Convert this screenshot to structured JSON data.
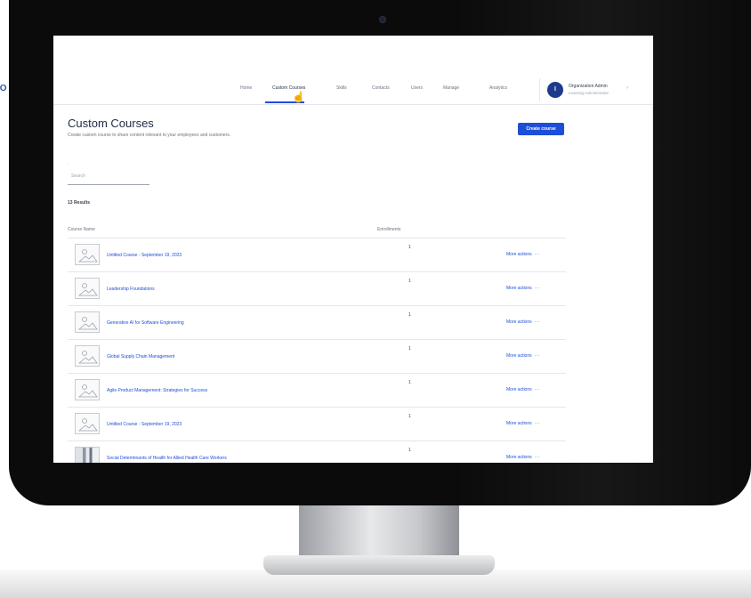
{
  "app": {
    "logo_text": "CO"
  },
  "nav": {
    "items": [
      {
        "label": "Home",
        "active": false
      },
      {
        "label": "Custom Courses",
        "active": true
      },
      {
        "label": "Skills",
        "active": false
      },
      {
        "label": "Contacts",
        "active": false
      },
      {
        "label": "Users",
        "active": false
      },
      {
        "label": "Manage",
        "active": false
      },
      {
        "label": "Analytics",
        "active": false
      }
    ],
    "user_initial": "I",
    "user_name": "Organization Admin",
    "user_role": "Learning Administrator"
  },
  "page": {
    "title": "Custom Courses",
    "subtitle": "Create custom course to share content relevant to your employees and customers.",
    "create_button": "Create course",
    "search_label": "Search",
    "search_placeholder": "Search",
    "results_count": "13 Results"
  },
  "table": {
    "headers": [
      "Course Name",
      "Enrollments"
    ],
    "rows": [
      {
        "name": "Untitled Course - September 19, 2023",
        "enrollments": "1",
        "action": "More actions",
        "thumb": "placeholder"
      },
      {
        "name": "Leadership Foundations",
        "enrollments": "1",
        "action": "More actions",
        "thumb": "placeholder"
      },
      {
        "name": "Generative AI for Software Engineering",
        "enrollments": "1",
        "action": "More actions",
        "thumb": "placeholder"
      },
      {
        "name": "Global Supply Chain Management",
        "enrollments": "1",
        "action": "More actions",
        "thumb": "placeholder"
      },
      {
        "name": "Agile Product Management: Strategies for Success",
        "enrollments": "1",
        "action": "More actions",
        "thumb": "placeholder"
      },
      {
        "name": "Untitled Course - September 19, 2023",
        "enrollments": "1",
        "action": "More actions",
        "thumb": "placeholder"
      },
      {
        "name": "Social Determinants of Health for Allied Health Care Workers",
        "enrollments": "1",
        "action": "More actions",
        "thumb": "photo"
      }
    ]
  },
  "icons": {
    "search": "search-icon",
    "more": "more-dots-icon",
    "chevron": "chevron-down-icon",
    "cursor": "pointer-hand-icon"
  },
  "colors": {
    "primary": "#1d4ed8",
    "avatar": "#1e3a8a",
    "bezel": "#0b0b0c"
  }
}
